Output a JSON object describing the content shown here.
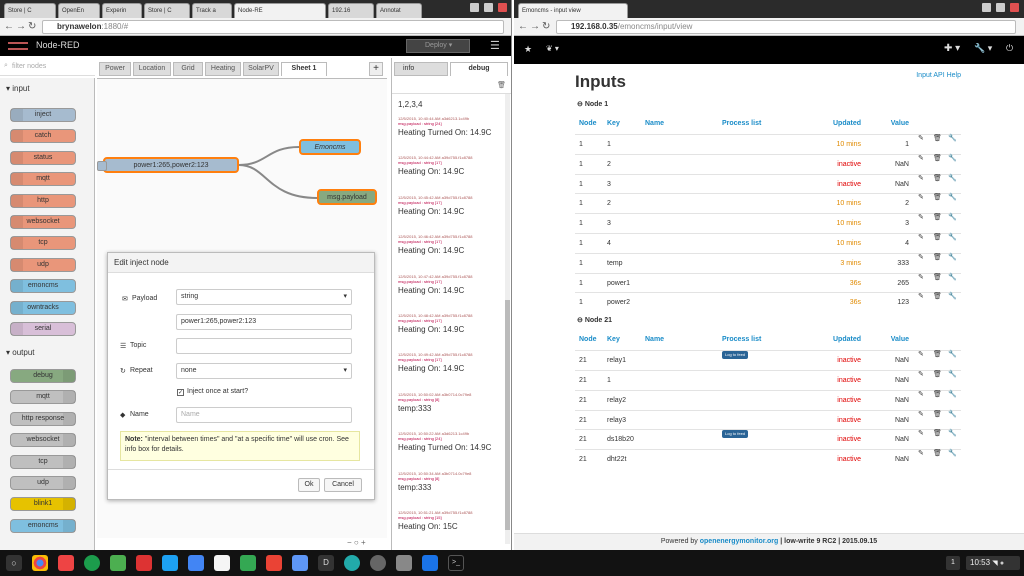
{
  "left": {
    "tabs": [
      "Store | C",
      "OpenEn",
      "Experin",
      "Store | C",
      "Track a",
      "Node-RE",
      "192.16",
      "Annotat"
    ],
    "url_host": "brynawelon",
    "url_rest": ":1880/#",
    "brand": "Node-RED",
    "deploy": "Deploy",
    "filter_placeholder": "filter nodes",
    "input_section": "input",
    "output_section": "output",
    "input_nodes": [
      "inject",
      "catch",
      "status",
      "mqtt",
      "http",
      "websocket",
      "tcp",
      "udp",
      "emoncms",
      "owntracks",
      "serial"
    ],
    "output_nodes": [
      "debug",
      "mqtt",
      "http response",
      "websocket",
      "tcp",
      "udp",
      "blink1",
      "emoncms"
    ],
    "ws_tabs": [
      "Power",
      "Location",
      "Grid",
      "Heating",
      "SolarPV",
      "Sheet 1"
    ],
    "flow_nodes": {
      "inject": "power1:265,power2:123",
      "emoncms": "Emoncms",
      "debug": "msg.payload"
    },
    "side_tabs": [
      "info",
      "debug"
    ],
    "debug_first": "1,2,3,4",
    "debug_msgs": [
      {
        "meta": "12/5/2015, 10:40:44 AM   a3d6213.1c49b",
        "type": "msg.payload : string [24]",
        "text": "Heating Turned On: 14.9C"
      },
      {
        "meta": "12/5/2015, 10:44:42 AM   a39d755.f1c8788",
        "type": "msg.payload : string [17]",
        "text": "Heating On: 14.9C"
      },
      {
        "meta": "12/5/2015, 10:45:42 AM   a39d755.f1c8788",
        "type": "msg.payload : string [17]",
        "text": "Heating On: 14.9C"
      },
      {
        "meta": "12/5/2015, 10:46:42 AM   a39d755.f1c8788",
        "type": "msg.payload : string [17]",
        "text": "Heating On: 14.9C"
      },
      {
        "meta": "12/5/2015, 10:47:42 AM   a39d755.f1c8788",
        "type": "msg.payload : string [17]",
        "text": "Heating On: 14.9C"
      },
      {
        "meta": "12/5/2015, 10:48:42 AM   a39d755.f1c8788",
        "type": "msg.payload : string [17]",
        "text": "Heating On: 14.9C"
      },
      {
        "meta": "12/5/2015, 10:49:42 AM   a39d755.f1c8788",
        "type": "msg.payload : string [17]",
        "text": "Heating On: 14.9C"
      },
      {
        "meta": "12/5/2015, 10:50:02 AM   a3b0714.0c79e8",
        "type": "msg.payload : string [8]",
        "text": "temp:333"
      },
      {
        "meta": "12/5/2015, 10:50:22 AM   a3d6213.1c49b",
        "type": "msg.payload : string [24]",
        "text": "Heating Turned On: 14.9C"
      },
      {
        "meta": "12/5/2015, 10:50:34 AM   a3b0714.0c79e8",
        "type": "msg.payload : string [8]",
        "text": "temp:333"
      },
      {
        "meta": "12/5/2015, 10:51:21 AM   a39d755.f1c8788",
        "type": "msg.payload : string [15]",
        "text": "Heating On: 15C"
      }
    ],
    "dialog": {
      "title": "Edit inject node",
      "payload_label": "Payload",
      "payload_type": "string",
      "payload_value": "power1:265,power2:123",
      "topic_label": "Topic",
      "repeat_label": "Repeat",
      "repeat_value": "none",
      "inject_once": "Inject once at start?",
      "name_label": "Name",
      "name_placeholder": "Name",
      "note_bold": "Note:",
      "note_text": " \"interval between times\" and \"at a specific time\" will use cron. See info box for details.",
      "ok": "Ok",
      "cancel": "Cancel"
    }
  },
  "right": {
    "tab": "Emoncms - input view",
    "url_host": "192.168.0.35",
    "url_rest": "/emoncms/input/view",
    "title": "Inputs",
    "api_help": "Input API Help",
    "cols": {
      "node": "Node",
      "key": "Key",
      "name": "Name",
      "process": "Process list",
      "updated": "Updated",
      "value": "Value"
    },
    "groups": [
      {
        "label": "Node 1",
        "rows": [
          {
            "node": "1",
            "key": "1",
            "proc": "",
            "updated": "10 mins",
            "value": "1",
            "st": "o"
          },
          {
            "node": "1",
            "key": "2",
            "proc": "",
            "updated": "inactive",
            "value": "NaN",
            "st": "r"
          },
          {
            "node": "1",
            "key": "3",
            "proc": "",
            "updated": "inactive",
            "value": "NaN",
            "st": "r"
          },
          {
            "node": "1",
            "key": "2",
            "proc": "",
            "updated": "10 mins",
            "value": "2",
            "st": "o"
          },
          {
            "node": "1",
            "key": "3",
            "proc": "",
            "updated": "10 mins",
            "value": "3",
            "st": "o"
          },
          {
            "node": "1",
            "key": "4",
            "proc": "",
            "updated": "10 mins",
            "value": "4",
            "st": "o"
          },
          {
            "node": "1",
            "key": "temp",
            "proc": "",
            "updated": "3 mins",
            "value": "333",
            "st": "o"
          },
          {
            "node": "1",
            "key": "power1",
            "proc": "",
            "updated": "36s",
            "value": "265",
            "st": "o"
          },
          {
            "node": "1",
            "key": "power2",
            "proc": "",
            "updated": "36s",
            "value": "123",
            "st": "o"
          }
        ]
      },
      {
        "label": "Node 21",
        "rows": [
          {
            "node": "21",
            "key": "relay1",
            "proc": "Log to feed",
            "updated": "inactive",
            "value": "NaN",
            "st": "r"
          },
          {
            "node": "21",
            "key": "1",
            "proc": "",
            "updated": "inactive",
            "value": "NaN",
            "st": "r"
          },
          {
            "node": "21",
            "key": "relay2",
            "proc": "",
            "updated": "inactive",
            "value": "NaN",
            "st": "r"
          },
          {
            "node": "21",
            "key": "relay3",
            "proc": "",
            "updated": "inactive",
            "value": "NaN",
            "st": "r"
          },
          {
            "node": "21",
            "key": "ds18b20",
            "proc": "Log to feed",
            "updated": "inactive",
            "value": "NaN",
            "st": "r"
          },
          {
            "node": "21",
            "key": "dht22t",
            "proc": "",
            "updated": "inactive",
            "value": "NaN",
            "st": "r"
          }
        ]
      }
    ],
    "footer_pre": "Powered by ",
    "footer_link": "openenergymonitor.org",
    "footer_post": " | low-write 9 RC2 | 2015.09.15"
  },
  "shelf": {
    "badge": "1",
    "clock": "10:53"
  },
  "colors": {
    "orange": "#e08a00",
    "red": "#e00000",
    "link": "#1a8cc8",
    "input_node": "#a6bbcf",
    "debug_node": "#87a980",
    "emoncms_node": "#7fbfdf"
  }
}
